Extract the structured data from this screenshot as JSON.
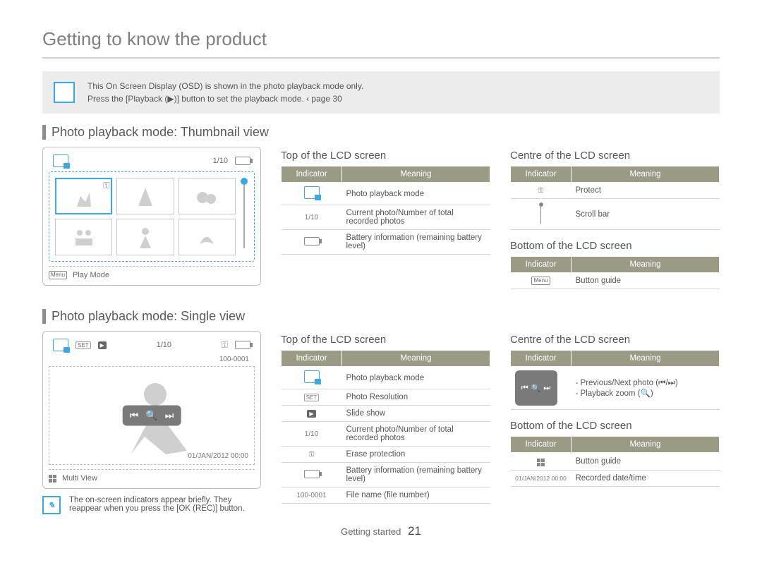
{
  "header": {
    "title": "Getting to know the product"
  },
  "info": {
    "line1": "This On Screen Display (OSD) is shown in the photo playback mode only.",
    "line2": "Press the [Playback (▶)] button to set the playback mode. ‹ page 30"
  },
  "section1": {
    "title": "Photo playback mode: Thumbnail view",
    "lcd": {
      "count": "1/10",
      "footer_label": "Play Mode"
    },
    "top": {
      "heading": "Top of the LCD screen",
      "th_indicator": "Indicator",
      "th_meaning": "Meaning",
      "rows": [
        {
          "ind": "photo-mode",
          "meaning": "Photo playback mode"
        },
        {
          "ind": "1/10",
          "meaning": "Current photo/Number of total recorded photos"
        },
        {
          "ind": "battery",
          "meaning": "Battery information (remaining battery level)"
        }
      ]
    },
    "centre": {
      "heading": "Centre of the LCD screen",
      "th_indicator": "Indicator",
      "th_meaning": "Meaning",
      "rows": [
        {
          "ind": "⚿",
          "meaning": "Protect"
        },
        {
          "ind": "scroll",
          "meaning": "Scroll bar"
        }
      ]
    },
    "bottom": {
      "heading": "Bottom of the LCD screen",
      "th_indicator": "Indicator",
      "th_meaning": "Meaning",
      "rows": [
        {
          "ind": "Menu",
          "meaning": "Button guide"
        }
      ]
    }
  },
  "section2": {
    "title": "Photo playback mode: Single view",
    "lcd": {
      "count": "1/10",
      "file_number": "100-0001",
      "datetime": "01/JAN/2012 00:00",
      "footer_label": "Multi View"
    },
    "top": {
      "heading": "Top of the LCD screen",
      "th_indicator": "Indicator",
      "th_meaning": "Meaning",
      "rows": [
        {
          "ind": "photo-mode",
          "meaning": "Photo playback mode"
        },
        {
          "ind": "SET",
          "meaning": "Photo Resolution"
        },
        {
          "ind": "▶",
          "meaning": "Slide show"
        },
        {
          "ind": "1/10",
          "meaning": "Current photo/Number of total recorded photos"
        },
        {
          "ind": "⚿",
          "meaning": "Erase protection"
        },
        {
          "ind": "battery",
          "meaning": "Battery information (remaining battery level)"
        },
        {
          "ind": "100-0001",
          "meaning": "File name (file number)"
        }
      ]
    },
    "centre": {
      "heading": "Centre of the LCD screen",
      "th_indicator": "Indicator",
      "th_meaning": "Meaning",
      "rows": [
        {
          "ind": "controls",
          "meaning": "- Previous/Next photo (⏮/⏭)\n- Playback zoom (🔍)"
        }
      ]
    },
    "bottom": {
      "heading": "Bottom of the LCD screen",
      "th_indicator": "Indicator",
      "th_meaning": "Meaning",
      "rows": [
        {
          "ind": "grid",
          "meaning": "Button guide"
        },
        {
          "ind": "01/JAN/2012 00:00",
          "meaning": "Recorded date/time"
        }
      ]
    }
  },
  "note": "The on-screen indicators appear briefly. They reappear when you press the [OK (REC)] button.",
  "footer": {
    "section": "Getting started",
    "page": "21"
  }
}
